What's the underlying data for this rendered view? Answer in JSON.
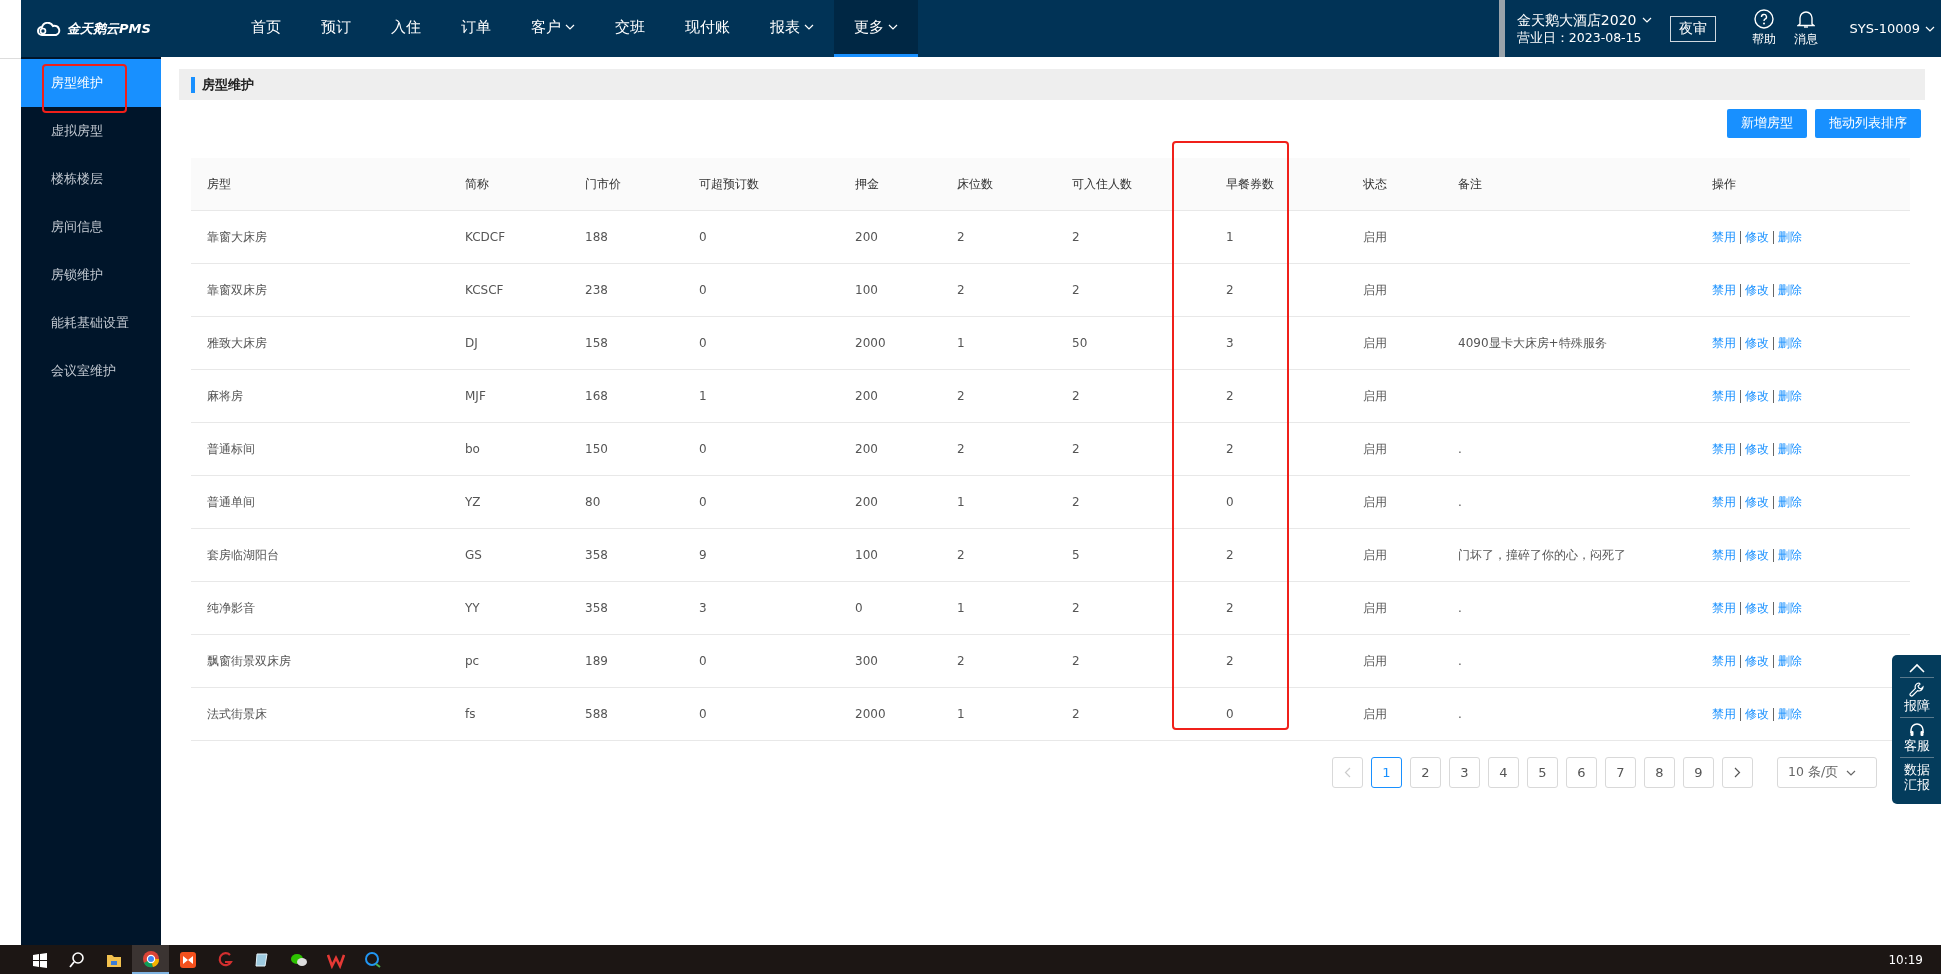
{
  "logo": {
    "text": "金天鹅云PMS"
  },
  "nav": [
    {
      "label": "首页",
      "dropdown": false,
      "selected": false
    },
    {
      "label": "预订",
      "dropdown": false,
      "selected": false
    },
    {
      "label": "入住",
      "dropdown": false,
      "selected": false
    },
    {
      "label": "订单",
      "dropdown": false,
      "selected": false
    },
    {
      "label": "客户",
      "dropdown": true,
      "selected": false
    },
    {
      "label": "交班",
      "dropdown": false,
      "selected": false
    },
    {
      "label": "现付账",
      "dropdown": false,
      "selected": false
    },
    {
      "label": "报表",
      "dropdown": true,
      "selected": false
    },
    {
      "label": "更多",
      "dropdown": true,
      "selected": true
    }
  ],
  "hotel": {
    "name": "金天鹅大酒店2020",
    "business_date": "营业日：2023-08-15"
  },
  "night_audit_button": "夜审",
  "help": {
    "label": "帮助"
  },
  "messages": {
    "label": "消息"
  },
  "user": "SYS-10009",
  "sidebar": {
    "items": [
      {
        "label": "房型维护",
        "selected": true
      },
      {
        "label": "虚拟房型",
        "selected": false
      },
      {
        "label": "楼栋楼层",
        "selected": false
      },
      {
        "label": "房间信息",
        "selected": false
      },
      {
        "label": "房锁维护",
        "selected": false
      },
      {
        "label": "能耗基础设置",
        "selected": false
      },
      {
        "label": "会议室维护",
        "selected": false
      }
    ]
  },
  "page_title": "房型维护",
  "toolbar_buttons": [
    "新增房型",
    "拖动列表排序"
  ],
  "table": {
    "columns": [
      "房型",
      "简称",
      "门市价",
      "可超预订数",
      "押金",
      "床位数",
      "可入住人数",
      "早餐券数",
      "状态",
      "备注",
      "操作"
    ],
    "rows": [
      {
        "cells": [
          "靠窗大床房",
          "KCDCF",
          "188",
          "0",
          "200",
          "2",
          "2",
          "1",
          "启用",
          ""
        ],
        "actions": [
          "禁用",
          "修改",
          "删除"
        ]
      },
      {
        "cells": [
          "靠窗双床房",
          "KCSCF",
          "238",
          "0",
          "100",
          "2",
          "2",
          "2",
          "启用",
          ""
        ],
        "actions": [
          "禁用",
          "修改",
          "删除"
        ]
      },
      {
        "cells": [
          "雅致大床房",
          "DJ",
          "158",
          "0",
          "2000",
          "1",
          "50",
          "3",
          "启用",
          "4090显卡大床房+特殊服务"
        ],
        "actions": [
          "禁用",
          "修改",
          "删除"
        ]
      },
      {
        "cells": [
          "麻将房",
          "MJF",
          "168",
          "1",
          "200",
          "2",
          "2",
          "2",
          "启用",
          ""
        ],
        "actions": [
          "禁用",
          "修改",
          "删除"
        ]
      },
      {
        "cells": [
          "普通标间",
          "bo",
          "150",
          "0",
          "200",
          "2",
          "2",
          "2",
          "启用",
          "."
        ],
        "actions": [
          "禁用",
          "修改",
          "删除"
        ]
      },
      {
        "cells": [
          "普通单间",
          "YZ",
          "80",
          "0",
          "200",
          "1",
          "2",
          "0",
          "启用",
          "."
        ],
        "actions": [
          "禁用",
          "修改",
          "删除"
        ]
      },
      {
        "cells": [
          "套房临湖阳台",
          "GS",
          "358",
          "9",
          "100",
          "2",
          "5",
          "2",
          "启用",
          "门坏了，撞碎了你的心，闷死了"
        ],
        "actions": [
          "禁用",
          "修改",
          "删除"
        ]
      },
      {
        "cells": [
          "纯净影音",
          "YY",
          "358",
          "3",
          "0",
          "1",
          "2",
          "2",
          "启用",
          "."
        ],
        "actions": [
          "禁用",
          "修改",
          "删除"
        ]
      },
      {
        "cells": [
          "飘窗街景双床房",
          "pc",
          "189",
          "0",
          "300",
          "2",
          "2",
          "2",
          "启用",
          "."
        ],
        "actions": [
          "禁用",
          "修改",
          "删除"
        ]
      },
      {
        "cells": [
          "法式街景床",
          "fs",
          "588",
          "0",
          "2000",
          "1",
          "2",
          "0",
          "启用",
          "."
        ],
        "actions": [
          "禁用",
          "修改",
          "删除"
        ]
      }
    ]
  },
  "pagination": {
    "prev_disabled": true,
    "pages": [
      {
        "label": "1",
        "selected": true
      },
      {
        "label": "2",
        "selected": false
      },
      {
        "label": "3",
        "selected": false
      },
      {
        "label": "4",
        "selected": false
      },
      {
        "label": "5",
        "selected": false
      },
      {
        "label": "6",
        "selected": false
      },
      {
        "label": "7",
        "selected": false
      },
      {
        "label": "8",
        "selected": false
      },
      {
        "label": "9",
        "selected": false
      }
    ],
    "page_size": "10 条/页"
  },
  "float_panel": {
    "items": [
      {
        "kind": "top"
      },
      {
        "kind": "wrench",
        "label": "报障"
      },
      {
        "kind": "headset",
        "label": "客服"
      },
      {
        "kind": "text",
        "label": "数据汇报"
      }
    ]
  },
  "taskbar": {
    "apps": [
      {
        "kind": "start",
        "selected": false
      },
      {
        "kind": "search",
        "selected": false
      },
      {
        "kind": "folder",
        "selected": false
      },
      {
        "kind": "browser",
        "selected": true
      },
      {
        "kind": "mail",
        "selected": false
      },
      {
        "kind": "swirl",
        "selected": false
      },
      {
        "kind": "notepad",
        "selected": false
      },
      {
        "kind": "chat",
        "selected": false
      },
      {
        "kind": "office",
        "selected": false
      },
      {
        "kind": "bubble",
        "selected": false
      }
    ],
    "time": "10:19"
  }
}
